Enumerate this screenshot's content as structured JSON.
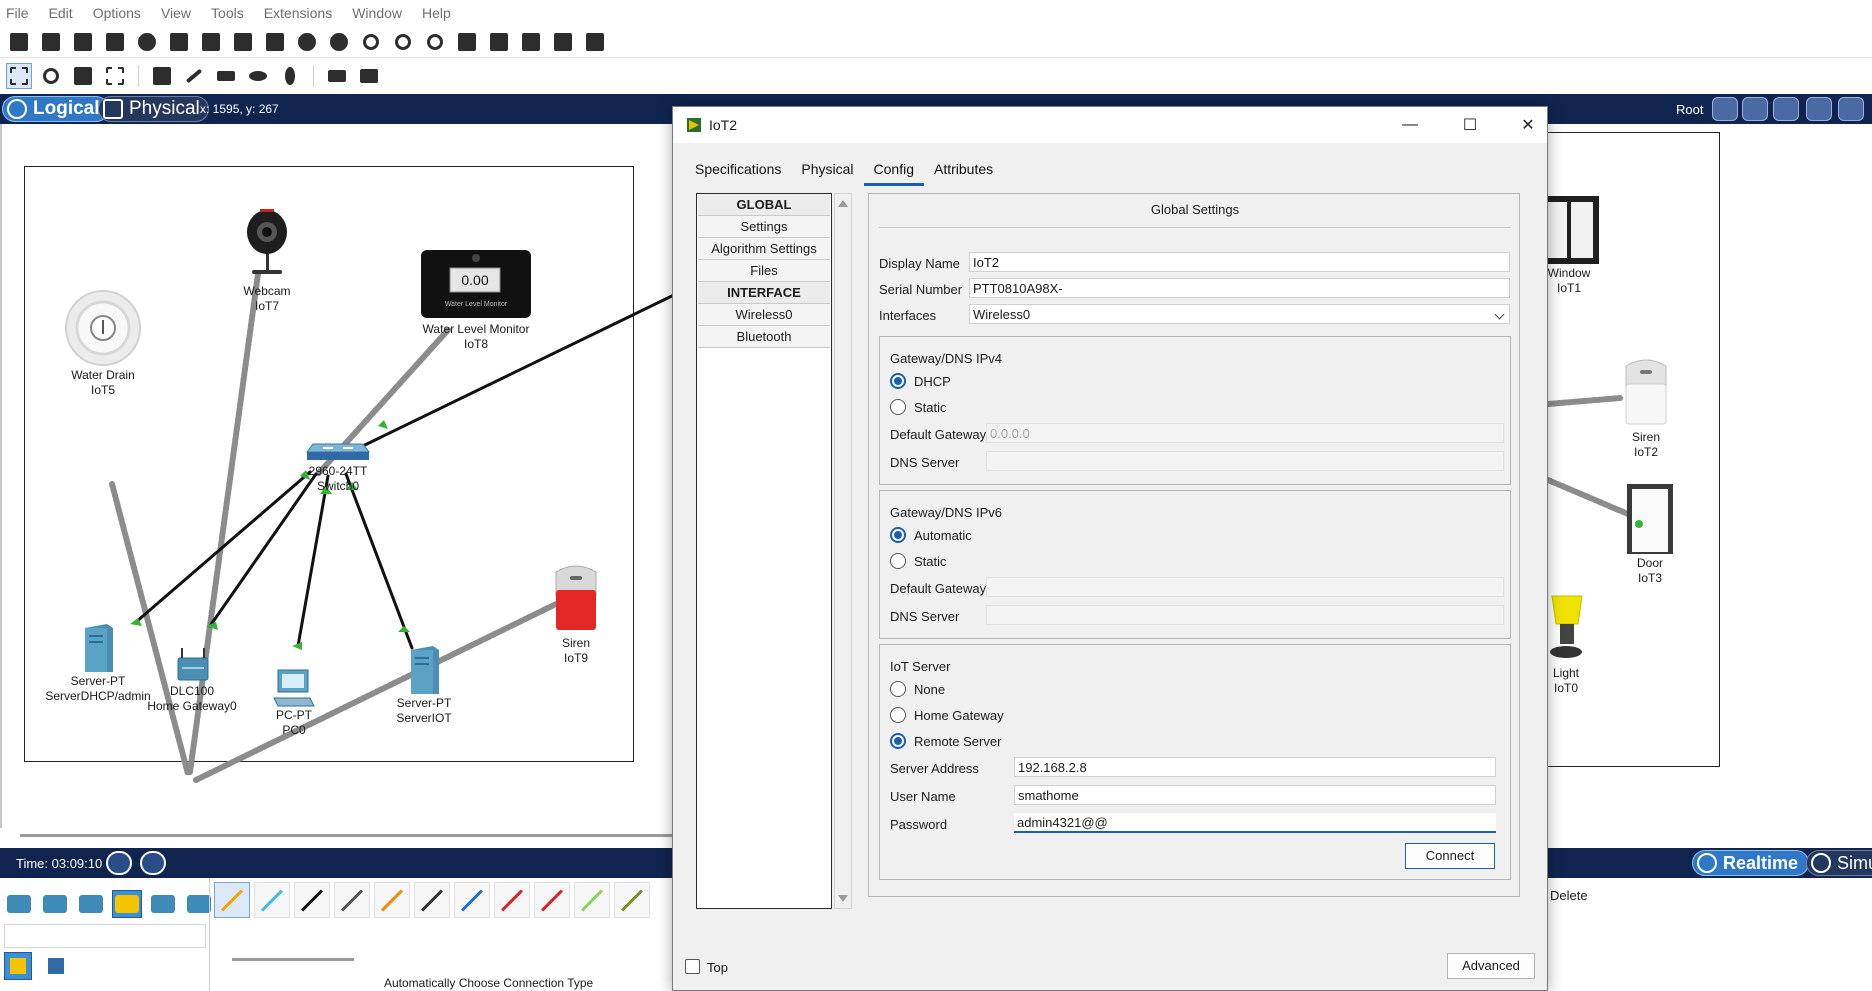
{
  "menu": [
    "File",
    "Edit",
    "Options",
    "View",
    "Tools",
    "Extensions",
    "Window",
    "Help"
  ],
  "workspace": {
    "mode_logical": "Logical",
    "mode_physical": "Physical",
    "coords": "x: 1595, y: 267",
    "root_label": "Root"
  },
  "devices": {
    "webcam": {
      "type": "Webcam",
      "name": "IoT7"
    },
    "water_level": {
      "type": "Water Level Monitor",
      "name": "IoT8",
      "display": "0.00",
      "caption": "Water Level Monitor"
    },
    "water_drain": {
      "type": "Water Drain",
      "name": "IoT5"
    },
    "switch": {
      "type": "2960-24TT",
      "name": "Switch0"
    },
    "server_dhcp": {
      "type": "Server-PT",
      "name": "ServerDHCP/admin"
    },
    "home_gateway": {
      "type": "DLC100",
      "name": "Home Gateway0"
    },
    "pc": {
      "type": "PC-PT",
      "name": "PC0"
    },
    "server_iot": {
      "type": "Server-PT",
      "name": "ServerIOT"
    },
    "siren_iot9": {
      "type": "Siren",
      "name": "IoT9"
    },
    "window": {
      "type": "Window",
      "name": "IoT1"
    },
    "siren_iot2": {
      "type": "Siren",
      "name": "IoT2"
    },
    "door": {
      "type": "Door",
      "name": "IoT3"
    },
    "light": {
      "type": "Light",
      "name": "IoT0"
    }
  },
  "timebar": {
    "time": "Time: 03:09:10",
    "realtime": "Realtime",
    "simulation": "Simu"
  },
  "bottom": {
    "connection_type": "Automatically Choose Connection Type",
    "delete": "Delete"
  },
  "dialog": {
    "title": "IoT2",
    "tabs": [
      "Specifications",
      "Physical",
      "Config",
      "Attributes"
    ],
    "active_tab": "Config",
    "sidebar": [
      "GLOBAL",
      "Settings",
      "Algorithm Settings",
      "Files",
      "INTERFACE",
      "Wireless0",
      "Bluetooth"
    ],
    "panel_title": "Global Settings",
    "display_name_label": "Display Name",
    "display_name": "IoT2",
    "serial_label": "Serial Number",
    "serial": "PTT0810A98X-",
    "interfaces_label": "Interfaces",
    "interface": "Wireless0",
    "ipv4": {
      "title": "Gateway/DNS IPv4",
      "opt_dhcp": "DHCP",
      "opt_static": "Static",
      "selected": "DHCP",
      "gateway_label": "Default Gateway",
      "gateway_value": "0.0.0.0",
      "dns_label": "DNS Server",
      "dns_value": ""
    },
    "ipv6": {
      "title": "Gateway/DNS IPv6",
      "opt_auto": "Automatic",
      "opt_static": "Static",
      "selected": "Automatic",
      "gateway_label": "Default Gateway",
      "gateway_value": "",
      "dns_label": "DNS Server",
      "dns_value": ""
    },
    "iot_server": {
      "title": "IoT Server",
      "opt_none": "None",
      "opt_home": "Home Gateway",
      "opt_remote": "Remote Server",
      "selected": "Remote Server",
      "address_label": "Server Address",
      "address": "192.168.2.8",
      "user_label": "User Name",
      "user": "smathome",
      "password_label": "Password",
      "password": "admin4321@@",
      "connect": "Connect"
    },
    "top_label": "Top",
    "advanced": "Advanced"
  },
  "colors": {
    "navbar": "#0f2550",
    "accent": "#1a5fb4",
    "link_green": "#33b233"
  }
}
